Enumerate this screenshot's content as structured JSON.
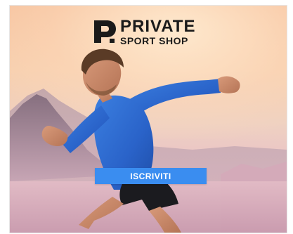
{
  "ad": {
    "brand": {
      "line1": "PRIVATE",
      "line2": "SPORT SHOP",
      "logo_icon": "private-sport-shop-logo-icon"
    },
    "cta": {
      "label": "ISCRIVITI"
    }
  },
  "colors": {
    "cta_background": "#3a8df0",
    "cta_text": "#ffffff",
    "logo_text": "#1a1a1a",
    "shirt": "#2f6fd6",
    "sky_top": "#f6c39f",
    "sky_bottom": "#d9a9ba"
  }
}
